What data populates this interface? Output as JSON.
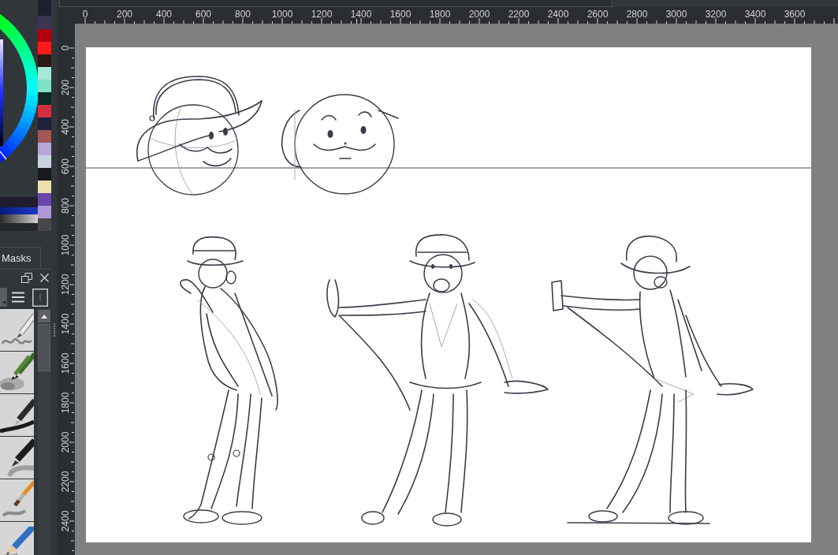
{
  "color_palette": [
    {
      "color": "#1c1f2e"
    },
    {
      "color": "#3b3550"
    },
    {
      "color": "#b00010"
    },
    {
      "color": "#ff1a1a"
    },
    {
      "color": "#2a1a12"
    },
    {
      "color": "#a8e8d8"
    },
    {
      "color": "#80e0c8"
    },
    {
      "color": "#0a2a28"
    },
    {
      "color": "#d03040"
    },
    {
      "color": "#20203a"
    },
    {
      "color": "#a05858"
    },
    {
      "color": "#b8a8d8"
    },
    {
      "color": "#c8d4e0"
    },
    {
      "color": "#1a1a1e"
    },
    {
      "color": "#ece0b0"
    },
    {
      "color": "#6848a8"
    },
    {
      "color": "#b098d8"
    },
    {
      "color": "#484848"
    }
  ],
  "docker": {
    "tab": {
      "label": "Masks"
    }
  },
  "brush_presets": [
    {
      "kind": "pencil"
    },
    {
      "kind": "crayon"
    },
    {
      "kind": "pen"
    },
    {
      "kind": "marker"
    },
    {
      "kind": "brush"
    },
    {
      "kind": "woodpencil"
    }
  ],
  "rulers": {
    "horizontal": [
      "0",
      "200",
      "400",
      "600",
      "800",
      "1000",
      "1200",
      "1400",
      "1600",
      "1800",
      "2000",
      "2200",
      "2400",
      "2600",
      "2800",
      "3000",
      "3200",
      "3400",
      "3600"
    ],
    "vertical": [
      "0",
      "200",
      "400",
      "600",
      "800",
      "1000",
      "1200",
      "1400",
      "1600",
      "1800",
      "2000",
      "2200",
      "2400"
    ]
  }
}
